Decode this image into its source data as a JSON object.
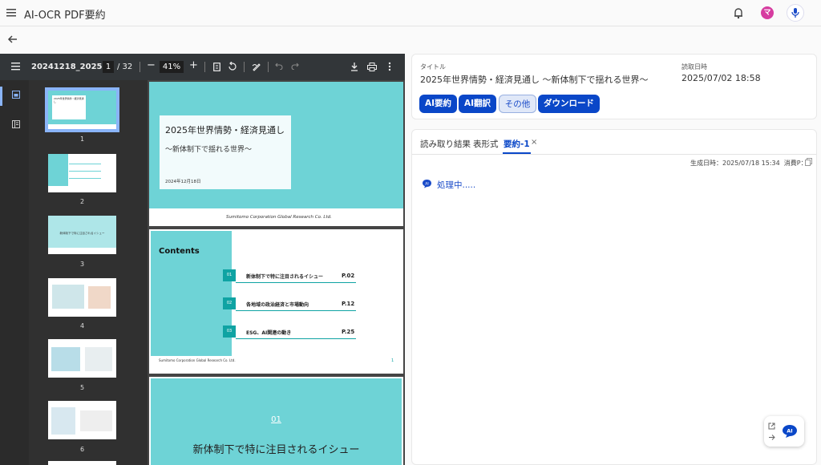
{
  "app": {
    "title": "AI-OCR PDF要約",
    "avatar_initial": "マ",
    "accent": "#0a47c8"
  },
  "viewer": {
    "filename": "20241218_2025...",
    "page_current": "1",
    "page_total": "/ 32",
    "zoom": "41%",
    "thumbnail_numbers": [
      "1",
      "2",
      "3",
      "4",
      "5",
      "6"
    ],
    "thumbnail_text": {
      "t1_title": "2025年世界情勢・経済見通し",
      "t3_text": "新体制下で特に注目されるイシュー"
    },
    "page1": {
      "title": "2025年世界情勢・経済見通し",
      "subtitle": "～新体制下で揺れる世界～",
      "date": "2024年12月18日",
      "footer": "Sumitomo Corporation Global Research Co. Ltd."
    },
    "page2": {
      "heading": "Contents",
      "items": [
        {
          "num": "01",
          "label": "新体制下で特に注目されるイシュー",
          "page": "P.02"
        },
        {
          "num": "02",
          "label": "各地域の政治経済と市場動向",
          "page": "P.12"
        },
        {
          "num": "03",
          "label": "ESG、AI関連の動き",
          "page": "P.25"
        }
      ],
      "footer": "Sumitomo Corporation Global Research Co. Ltd.",
      "page_no": "1"
    },
    "page3": {
      "num": "01",
      "title": "新体制下で特に注目されるイシュー"
    }
  },
  "info": {
    "title_label": "タイトル",
    "title_value": "2025年世界情勢・経済見通し ～新体制下で揺れる世界～",
    "date_label": "読取日時",
    "date_value": "2025/07/02 18:58",
    "buttons": {
      "summary": "AI要約",
      "translate": "AI翻訳",
      "other": "その他",
      "download": "ダウンロード"
    }
  },
  "result": {
    "tabs": {
      "ocr": "読み取り結果",
      "table": "表形式",
      "summary": "要約-1",
      "close": "×"
    },
    "meta": "生成日時：2025/07/18 15:34  消費P：-",
    "processing": "処理中....."
  },
  "float": {
    "ai_badge": "AI"
  }
}
